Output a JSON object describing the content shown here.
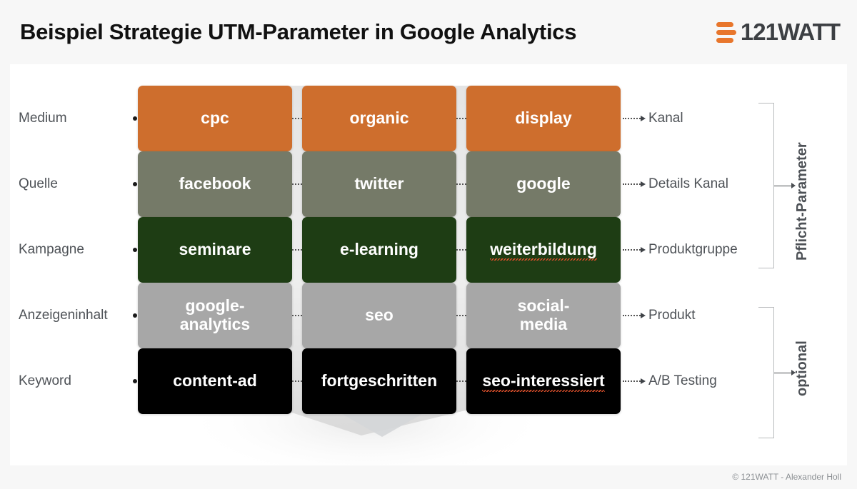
{
  "header": {
    "title": "Beispiel Strategie UTM-Parameter in Google Analytics",
    "logo_text": "121WATT",
    "logo_icon": "121watt-bars-icon"
  },
  "matrix": {
    "rows": [
      {
        "left_label": "Medium",
        "right_label": "Kanal",
        "color": "#ce6e2d",
        "cells": [
          "cpc",
          "organic",
          "display"
        ]
      },
      {
        "left_label": "Quelle",
        "right_label": "Details Kanal",
        "color": "#757a68",
        "cells": [
          "facebook",
          "twitter",
          "google"
        ]
      },
      {
        "left_label": "Kampagne",
        "right_label": "Produktgruppe",
        "color": "#1e3d14",
        "cells": [
          "seminare",
          "e-learning",
          "weiterbildung"
        ]
      },
      {
        "left_label": "Anzeigeninhalt",
        "right_label": "Produkt",
        "color": "#a7a7a7",
        "cells": [
          "google-\nanalytics",
          "seo",
          "social-\nmedia"
        ]
      },
      {
        "left_label": "Keyword",
        "right_label": "A/B Testing",
        "color": "#000000",
        "cells": [
          "content-ad",
          "fortgeschritten",
          "seo-interessiert"
        ]
      }
    ]
  },
  "groups": [
    {
      "label": "Pflicht-Parameter"
    },
    {
      "label": "optional"
    }
  ],
  "footer": {
    "copyright": "© 121WATT - Alexander Holl"
  },
  "colors": {
    "orange": "#ce6e2d",
    "sage": "#757a68",
    "dark_green": "#1e3d14",
    "gray": "#a7a7a7",
    "black": "#000000",
    "brand_orange": "#e8762c",
    "text_gray": "#4e5257",
    "page_bg": "#f7f7f7",
    "card_bg": "#ffffff"
  }
}
